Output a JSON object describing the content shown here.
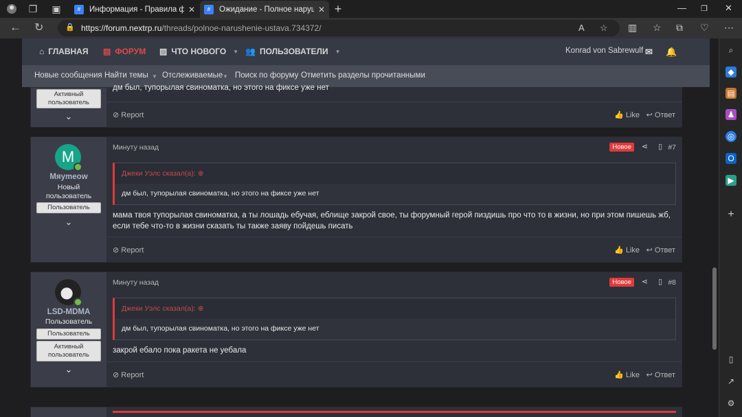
{
  "browser": {
    "tabs": [
      {
        "title": "Информация - Правила форума",
        "active": false
      },
      {
        "title": "Ожидание - Полное нарушение устава",
        "active": true
      }
    ],
    "new_tab": "+",
    "url_host": "https://forum.nextrp.ru",
    "url_path": "/threads/polnoe-narushenie-ustava.734372/"
  },
  "forum": {
    "nav": [
      "ГЛАВНАЯ",
      "ФОРУМ",
      "ЧТО НОВОГО",
      "ПОЛЬЗОВАТЕЛИ"
    ],
    "username": "Konrad von Sabrewulf",
    "subnav": [
      "Новые сообщения",
      "Найти темы",
      "Отслеживаемые",
      "Поиск по форуму",
      "Отметить разделы прочитанными"
    ]
  },
  "posts": [
    {
      "badges": [
        "Активный пользователь"
      ],
      "message": "дм был, тупорылая свиноматка, но этого на фиксе уже нет",
      "actions": {
        "report": "Report",
        "like": "Like",
        "reply": "Ответ"
      }
    },
    {
      "author": "Mяymeow",
      "avatar_letter": "M",
      "avatar_color": "#17a589",
      "user_title": "Новый пользователь",
      "badges": [
        "Пользователь"
      ],
      "time": "Минуту назад",
      "new_label": "Новое",
      "number": "#7",
      "quote_author": "Джеки Уэлс сказал(а):",
      "quote_text": "дм был, тупорылая свиноматка, но этого на фиксе уже нет",
      "message": "мама твоя тупорылая свиноматка, а ты лошадь ебучая, еблище закрой свое, ты форумный герой пиздишь про что то в жизни, но при этом пишешь жб, если тебе что-то в жизни сказать ты также заяву пойдешь писать",
      "actions": {
        "report": "Report",
        "like": "Like",
        "reply": "Ответ"
      }
    },
    {
      "author": "LSD-MDMA",
      "user_title": "Пользователь",
      "badges": [
        "Пользователь",
        "Активный пользователь"
      ],
      "time": "Минуту назад",
      "new_label": "Новое",
      "number": "#8",
      "quote_author": "Джеки Уэлс сказал(а):",
      "quote_text": "дм был, тупорылая свиноматка, но этого на фиксе уже нет",
      "message": "закрой ебало пока ракета не уебала",
      "actions": {
        "report": "Report",
        "like": "Like",
        "reply": "Ответ"
      }
    }
  ],
  "colors": {
    "accent": "#e03a3a",
    "online": "#6dbb4c"
  }
}
